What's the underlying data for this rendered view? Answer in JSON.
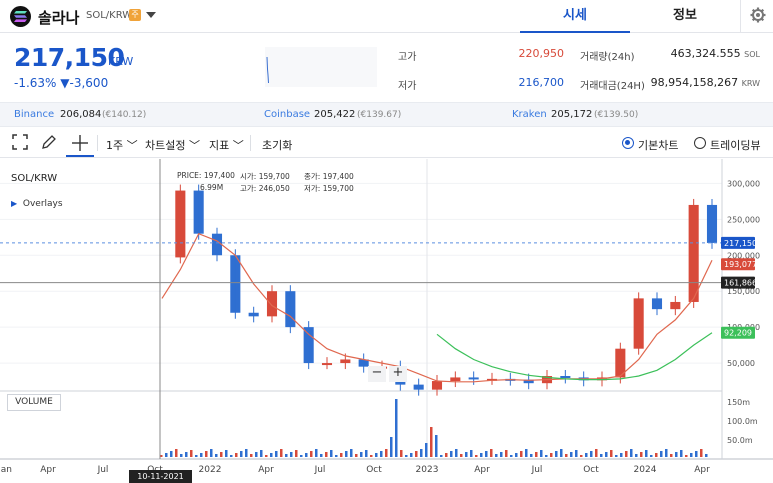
{
  "header": {
    "coin_name": "솔라나",
    "pair": "SOL/KRW",
    "badge": "주",
    "tab_quote": "시세",
    "tab_info": "정보"
  },
  "price": {
    "current": "217,150",
    "unit": "KRW",
    "change_pct": "-1.63%",
    "change_arrow": "▼",
    "change_amt": "-3,600",
    "color_down": "#1a56c9",
    "color_up": "#d84a3a"
  },
  "stats": {
    "high_label": "고가",
    "high_value": "220,950",
    "low_label": "저가",
    "low_value": "216,700",
    "volume_label": "거래량(24h)",
    "volume_value": "463,324.555",
    "volume_unit": "SOL",
    "turnover_label": "거래대금(24H)",
    "turnover_value": "98,954,158,267",
    "turnover_unit": "KRW"
  },
  "exchanges": [
    {
      "name": "Binance",
      "price": "206,084",
      "sub": "(€140.12)"
    },
    {
      "name": "Coinbase",
      "price": "205,422",
      "sub": "(€139.67)"
    },
    {
      "name": "Kraken",
      "price": "205,172",
      "sub": "(€139.50)"
    }
  ],
  "toolbar": {
    "period": "1주",
    "chart_settings": "차트설정",
    "indicators": "지표",
    "reset": "초기화",
    "basic_chart": "기본차트",
    "trading_view": "트레이딩뷰"
  },
  "chart": {
    "pair_label": "SOL/KRW",
    "overlays_label": "Overlays",
    "volume_label": "VOLUME",
    "zoom_out": "−",
    "zoom_in": "+",
    "date_flag": "10-11-2021",
    "ohlc": {
      "price_label": "PRICE:",
      "price_value": "197,400",
      "vol_value": "6.99M",
      "open_label": "시가:",
      "open_value": "159,700",
      "high_label": "고가:",
      "high_value": "246,050",
      "close_label": "종가:",
      "close_value": "197,400",
      "low_label": "저가:",
      "low_value": "159,700"
    },
    "markers": {
      "current": "217,150",
      "ma_short": "193,077",
      "crosshair": "161,866",
      "ma_long": "92,209"
    }
  },
  "chart_data": {
    "type": "line",
    "title": "SOL/KRW",
    "price_ticks": [
      "300,000",
      "250,000",
      "200,000",
      "150,000",
      "100,000",
      "50,000"
    ],
    "volume_ticks": [
      "150m",
      "100.0m",
      "50.0m"
    ],
    "x_ticks": [
      "Jan",
      "Apr",
      "Jul",
      "Oct",
      "2022",
      "Apr",
      "Jul",
      "Oct",
      "2023",
      "Apr",
      "Jul",
      "Oct",
      "2024",
      "Apr"
    ],
    "series": [
      {
        "name": "SOL/KRW",
        "color": "#3a6fd0",
        "x": [
          "2021-10",
          "2021-11",
          "2021-12",
          "2022-01",
          "2022-02",
          "2022-03",
          "2022-04",
          "2022-05",
          "2022-06",
          "2022-07",
          "2022-08",
          "2022-09",
          "2022-10",
          "2022-11",
          "2022-12",
          "2023-01",
          "2023-02",
          "2023-03",
          "2023-04",
          "2023-05",
          "2023-06",
          "2023-07",
          "2023-08",
          "2023-09",
          "2023-10",
          "2023-11",
          "2023-12",
          "2024-01",
          "2024-02",
          "2024-03",
          "2024-04"
        ],
        "values": [
          197000,
          290000,
          230000,
          200000,
          120000,
          115000,
          150000,
          100000,
          50000,
          50000,
          55000,
          45000,
          45000,
          20000,
          13000,
          25000,
          30000,
          28000,
          28000,
          27000,
          22000,
          32000,
          30000,
          26000,
          30000,
          70000,
          140000,
          125000,
          135000,
          270000,
          217150
        ]
      },
      {
        "name": "",
        "color": "#e0684f",
        "values": [
          140000,
          180000,
          230000,
          220000,
          200000,
          160000,
          130000,
          115000,
          90000,
          70000,
          60000,
          55000,
          50000,
          45000,
          35000,
          25000,
          24000,
          24000,
          26000,
          27000,
          26000,
          27000,
          28000,
          28000,
          28000,
          32000,
          55000,
          90000,
          110000,
          140000,
          193077
        ]
      },
      {
        "name": "",
        "color": "#3cc05a",
        "values": [
          null,
          null,
          null,
          null,
          null,
          null,
          null,
          null,
          null,
          null,
          null,
          null,
          null,
          null,
          null,
          90000,
          70000,
          55000,
          45000,
          38000,
          33000,
          30000,
          28000,
          27000,
          27000,
          28000,
          32000,
          40000,
          55000,
          75000,
          92209
        ]
      }
    ],
    "ylim": [
      0,
      320000
    ],
    "grid": true
  }
}
